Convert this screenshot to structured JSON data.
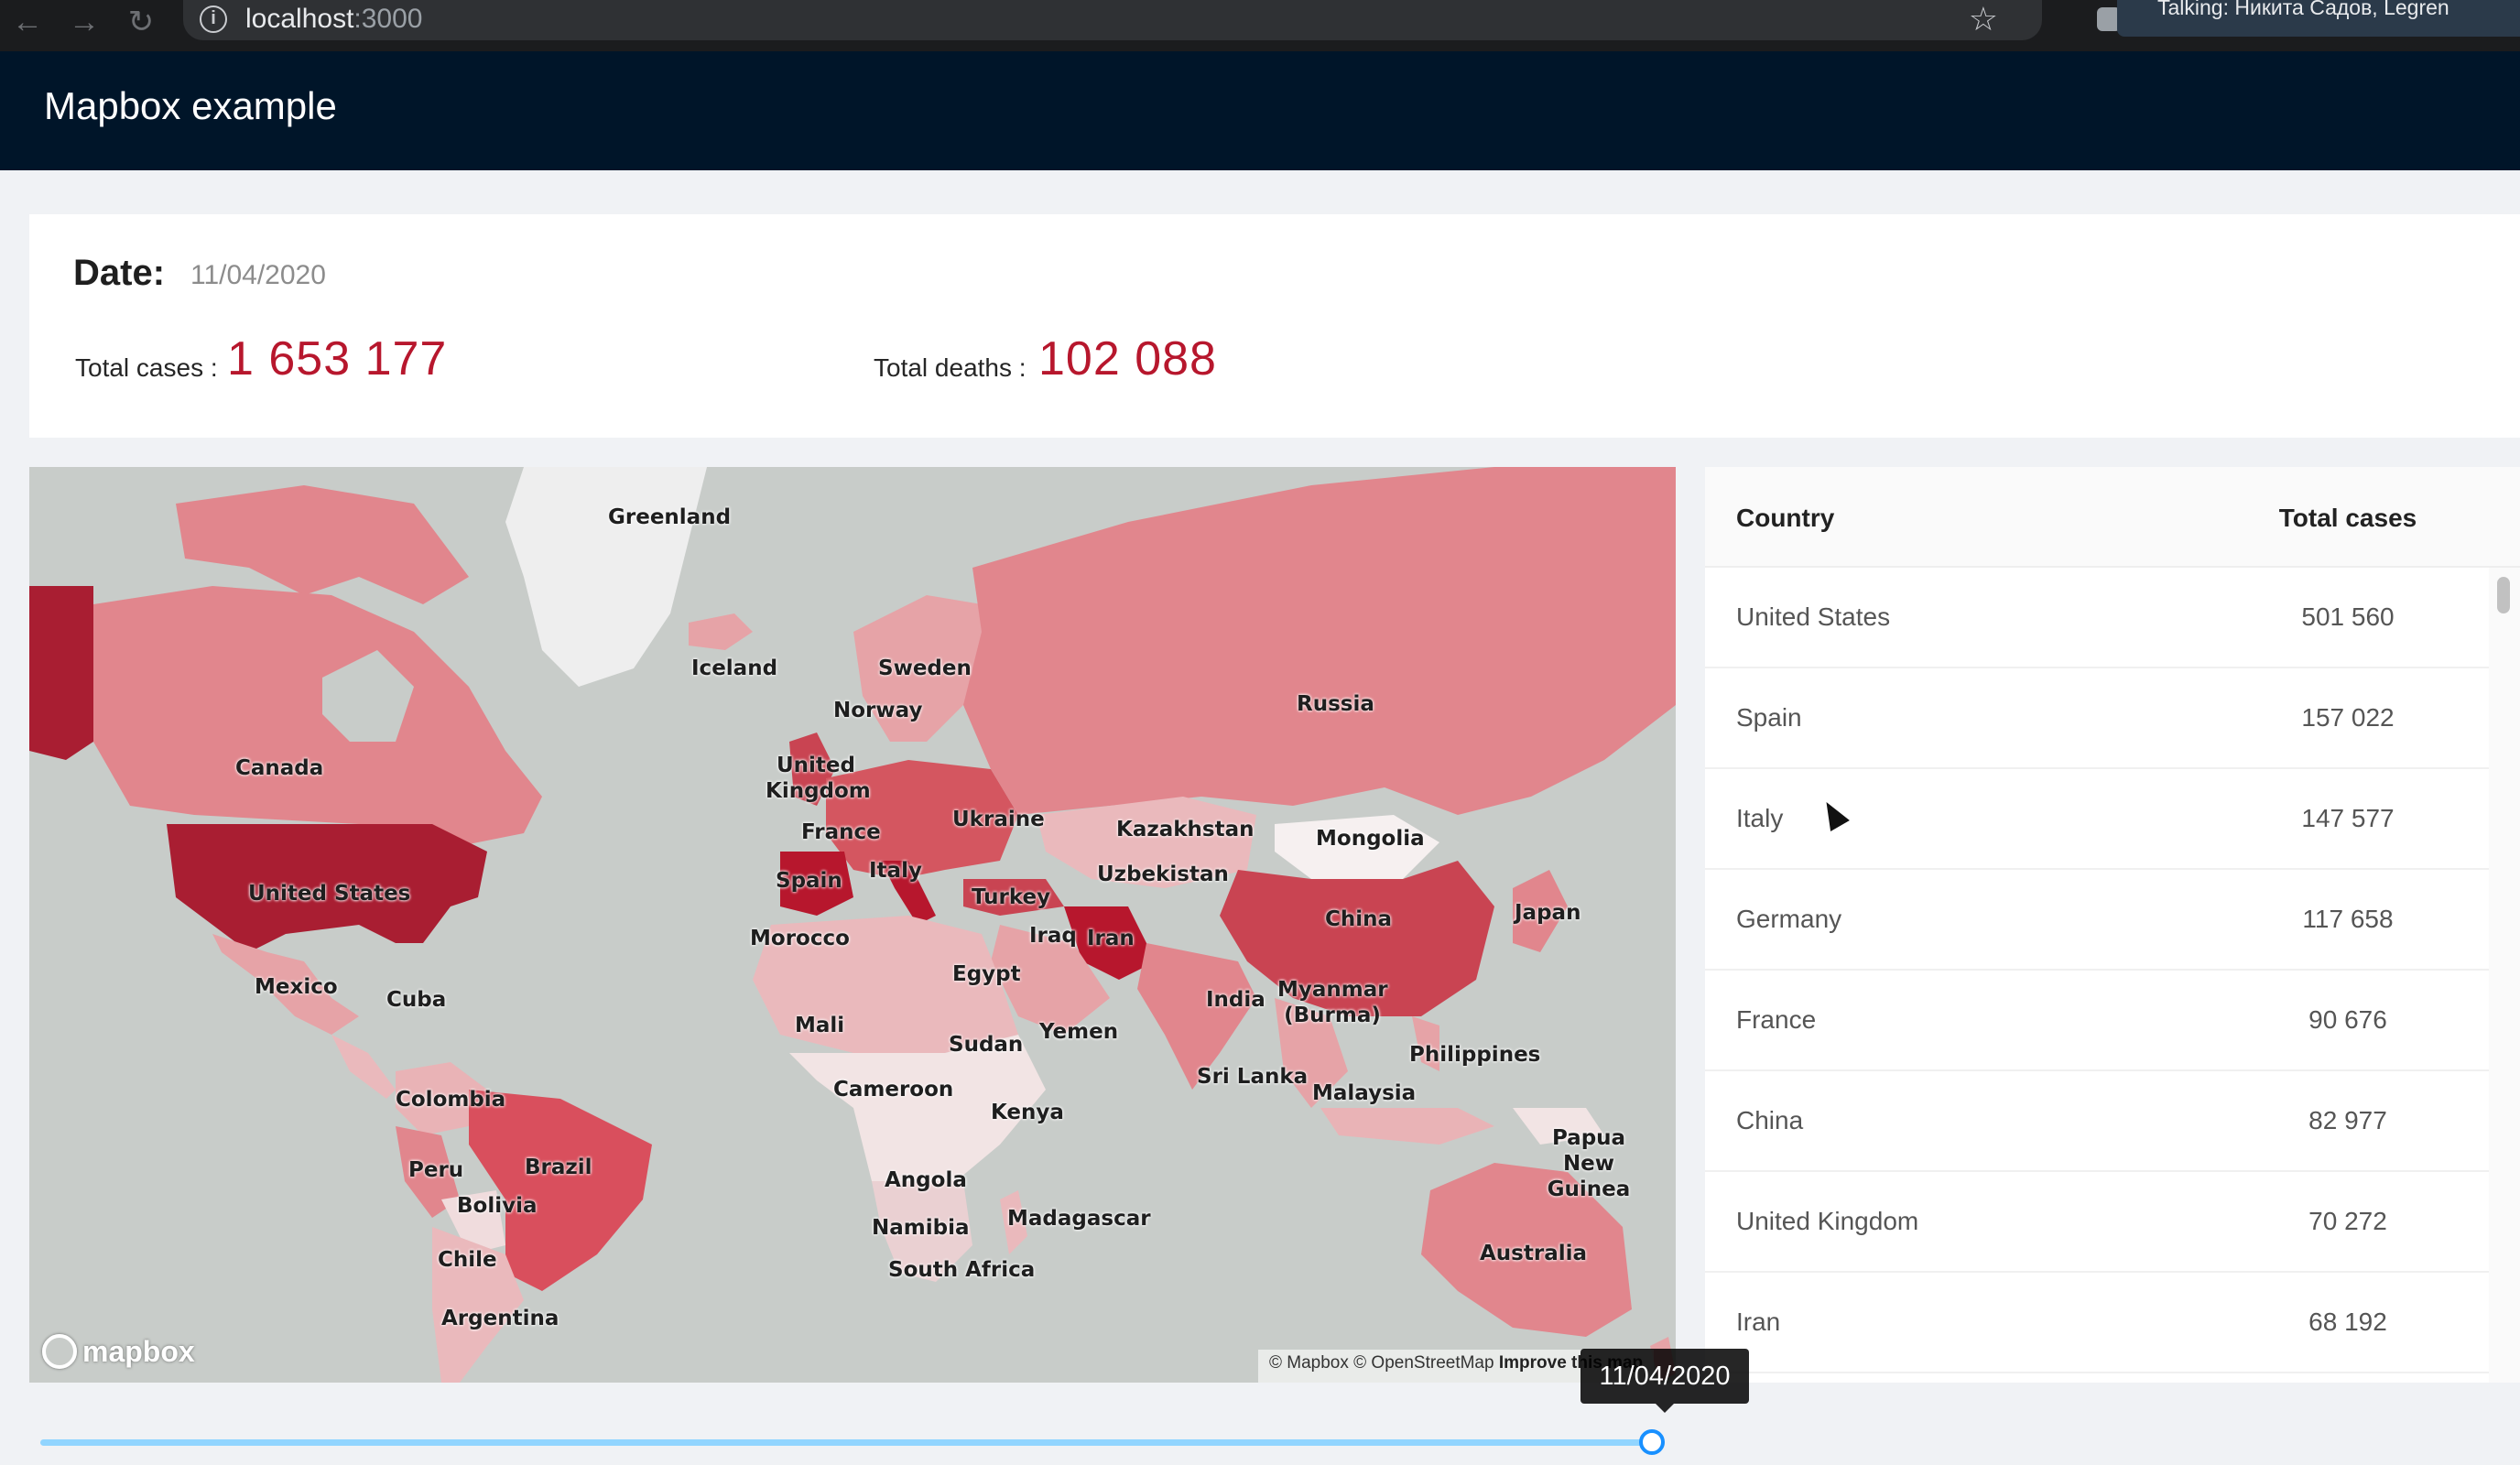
{
  "browser": {
    "url_host": "localhost",
    "url_port": ":3000",
    "talking": "Talking: Никита Садов, Legren"
  },
  "header": {
    "title": "Mapbox example"
  },
  "summary": {
    "date_label": "Date:",
    "date_value": "11/04/2020",
    "cases_label": "Total cases :",
    "cases_value": "1 653 177",
    "deaths_label": "Total deaths :",
    "deaths_value": "102 088"
  },
  "map": {
    "labels": [
      "Greenland",
      "Iceland",
      "Sweden",
      "Norway",
      "Russia",
      "United Kingdom",
      "Canada",
      "France",
      "Ukraine",
      "Kazakhstan",
      "Mongolia",
      "United States",
      "Spain",
      "Italy",
      "Uzbekistan",
      "Turkey",
      "China",
      "Japan",
      "Iraq",
      "Iran",
      "Morocco",
      "Mexico",
      "Cuba",
      "Egypt",
      "Myanmar (Burma)",
      "India",
      "Mali",
      "Sudan",
      "Yemen",
      "Philippines",
      "Sri Lanka",
      "Colombia",
      "Cameroon",
      "Malaysia",
      "Kenya",
      "Papua New Guinea",
      "Peru",
      "Brazil",
      "Bolivia",
      "Angola",
      "Namibia",
      "Madagascar",
      "Australia",
      "Chile",
      "South Africa",
      "Argentina"
    ],
    "logo_text": "mapbox",
    "attribution": "© Mapbox © OpenStreetMap",
    "attribution_link": "Improve this map",
    "colors": {
      "water": "#c8ccc9",
      "low": "#f2e4e4",
      "mid": "#e1868d",
      "high": "#b7172d"
    }
  },
  "table": {
    "headers": {
      "country": "Country",
      "cases": "Total cases"
    },
    "rows": [
      {
        "country": "United States",
        "cases": "501 560"
      },
      {
        "country": "Spain",
        "cases": "157 022"
      },
      {
        "country": "Italy",
        "cases": "147 577"
      },
      {
        "country": "Germany",
        "cases": "117 658"
      },
      {
        "country": "France",
        "cases": "90 676"
      },
      {
        "country": "China",
        "cases": "82 977"
      },
      {
        "country": "United Kingdom",
        "cases": "70 272"
      },
      {
        "country": "Iran",
        "cases": "68 192"
      }
    ]
  },
  "slider": {
    "tooltip": "11/04/2020",
    "position": 1.0
  }
}
